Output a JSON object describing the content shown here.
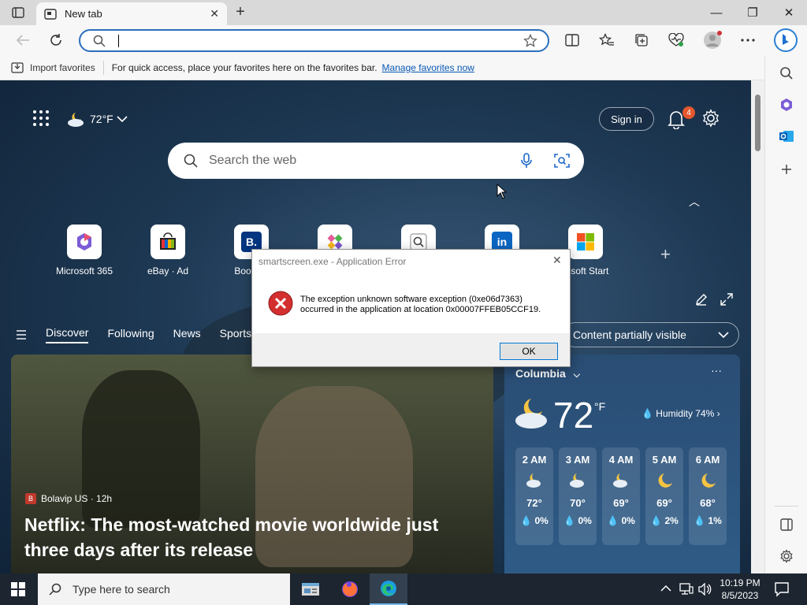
{
  "browser": {
    "tab_title": "New tab",
    "tab_close": "✕",
    "new_tab": "+",
    "window_controls": {
      "minimize": "—",
      "maximize": "❐",
      "close": "✕"
    },
    "address_value": "",
    "favorites_bar": {
      "import_label": "Import favorites",
      "quick_access_text": "For quick access, place your favorites here on the favorites bar.",
      "manage_link": "Manage favorites now"
    }
  },
  "newtab": {
    "weather_temp": "72°F",
    "sign_in": "Sign in",
    "notification_count": "4",
    "search_placeholder": "Search the web",
    "collapse": "︿",
    "tiles": [
      {
        "label": "Microsoft 365",
        "icon": "microsoft-365-icon"
      },
      {
        "label": "eBay · Ad",
        "icon": "ebay-icon"
      },
      {
        "label": "Booking",
        "icon": "booking-icon"
      },
      {
        "label": "",
        "icon": "game-icon"
      },
      {
        "label": "",
        "icon": "search-tile-icon"
      },
      {
        "label": "",
        "icon": "linkedin-icon"
      },
      {
        "label": "rosoft Start",
        "icon": "microsoft-start-icon"
      }
    ],
    "add_tile": "+",
    "feed_nav": [
      "Discover",
      "Following",
      "News",
      "Sports"
    ],
    "content_visibility": "Content partially visible",
    "news": {
      "source": "Bolavip US · 12h",
      "headline": "Netflix: The most-watched movie worldwide just three days after its release"
    },
    "weather_card": {
      "city": "Columbia",
      "more": "···",
      "temp": "72",
      "unit": "°F",
      "humidity": "Humidity 74%",
      "hourly": [
        {
          "time": "2 AM",
          "temp": "72°",
          "precip": "0%",
          "icon": "partly-cloudy-night-icon"
        },
        {
          "time": "3 AM",
          "temp": "70°",
          "precip": "0%",
          "icon": "partly-cloudy-night-icon"
        },
        {
          "time": "4 AM",
          "temp": "69°",
          "precip": "0%",
          "icon": "partly-cloudy-night-icon"
        },
        {
          "time": "5 AM",
          "temp": "69°",
          "precip": "2%",
          "icon": "moon-icon"
        },
        {
          "time": "6 AM",
          "temp": "68°",
          "precip": "1%",
          "icon": "moon-icon"
        }
      ]
    }
  },
  "dialog": {
    "title": "smartscreen.exe - Application Error",
    "close": "✕",
    "message_line1": "The exception unknown software exception (0xe06d7363)",
    "message_line2": "occurred in the application at location 0x00007FFEB05CCF19.",
    "ok": "OK"
  },
  "taskbar": {
    "search_placeholder": "Type here to search",
    "time": "10:19 PM",
    "date": "8/5/2023"
  },
  "colors": {
    "accent": "#0078d7",
    "error_red": "#d32f2f",
    "badge": "#e4572e"
  }
}
